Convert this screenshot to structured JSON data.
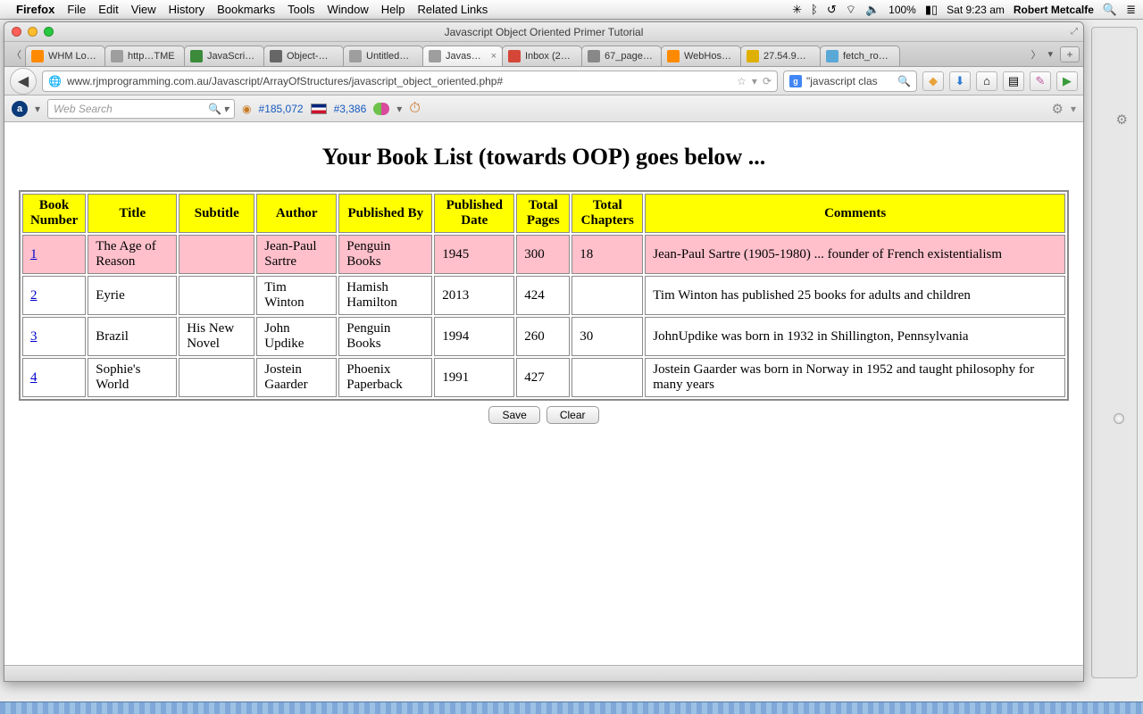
{
  "mac": {
    "app": "Firefox",
    "menus": [
      "File",
      "Edit",
      "View",
      "History",
      "Bookmarks",
      "Tools",
      "Window",
      "Help",
      "Related Links"
    ],
    "battery": "100%",
    "clock": "Sat 9:23 am",
    "user": "Robert Metcalfe"
  },
  "window": {
    "title": "Javascript Object Oriented Primer Tutorial"
  },
  "tabs": [
    {
      "label": "WHM Lo…",
      "fav": "#ff8a00"
    },
    {
      "label": "http…TME",
      "fav": "#9e9e9e"
    },
    {
      "label": "JavaScri…",
      "fav": "#3b8b3b"
    },
    {
      "label": "Object-…",
      "fav": "#666"
    },
    {
      "label": "Untitled…",
      "fav": "#9e9e9e"
    },
    {
      "label": "Javas…",
      "fav": "#9e9e9e",
      "active": true
    },
    {
      "label": "Inbox (2…",
      "fav": "#d44638"
    },
    {
      "label": "67_page…",
      "fav": "#888"
    },
    {
      "label": "WebHos…",
      "fav": "#ff8a00"
    },
    {
      "label": "27.54.9…",
      "fav": "#e0b000"
    },
    {
      "label": "fetch_ro…",
      "fav": "#5aa8d6"
    }
  ],
  "nav": {
    "url": "www.rjmprogramming.com.au/Javascript/ArrayOfStructures/javascript_object_oriented.php#",
    "search_value": "\"javascript clas"
  },
  "ask": {
    "placeholder": "Web Search",
    "rank1": "#185,072",
    "rank2": "#3,386"
  },
  "page": {
    "heading": "Your Book List (towards OOP) goes below ...",
    "columns": [
      "Book Number",
      "Title",
      "Subtitle",
      "Author",
      "Published By",
      "Published Date",
      "Total Pages",
      "Total Chapters",
      "Comments"
    ],
    "rows": [
      {
        "hl": true,
        "num": "1",
        "title": "The Age of Reason",
        "subtitle": "",
        "author": "Jean-Paul Sartre",
        "publisher": "Penguin Books",
        "date": "1945",
        "pages": "300",
        "chapters": "18",
        "comments": "Jean-Paul Sartre (1905-1980) ... founder of French existentialism"
      },
      {
        "num": "2",
        "title": "Eyrie",
        "subtitle": "",
        "author": "Tim Winton",
        "publisher": "Hamish Hamilton",
        "date": "2013",
        "pages": "424",
        "chapters": "",
        "comments": "Tim Winton has published 25 books for adults and children"
      },
      {
        "num": "3",
        "title": "Brazil",
        "subtitle": "His New Novel",
        "author": "John Updike",
        "publisher": "Penguin Books",
        "date": "1994",
        "pages": "260",
        "chapters": "30",
        "comments": "JohnUpdike was born in 1932 in Shillington, Pennsylvania"
      },
      {
        "num": "4",
        "title": "Sophie's World",
        "subtitle": "",
        "author": "Jostein Gaarder",
        "publisher": "Phoenix Paperback",
        "date": "1991",
        "pages": "427",
        "chapters": "",
        "comments": "Jostein Gaarder was born in Norway in 1952 and taught philosophy for many years"
      }
    ],
    "buttons": {
      "save": "Save",
      "clear": "Clear"
    }
  }
}
